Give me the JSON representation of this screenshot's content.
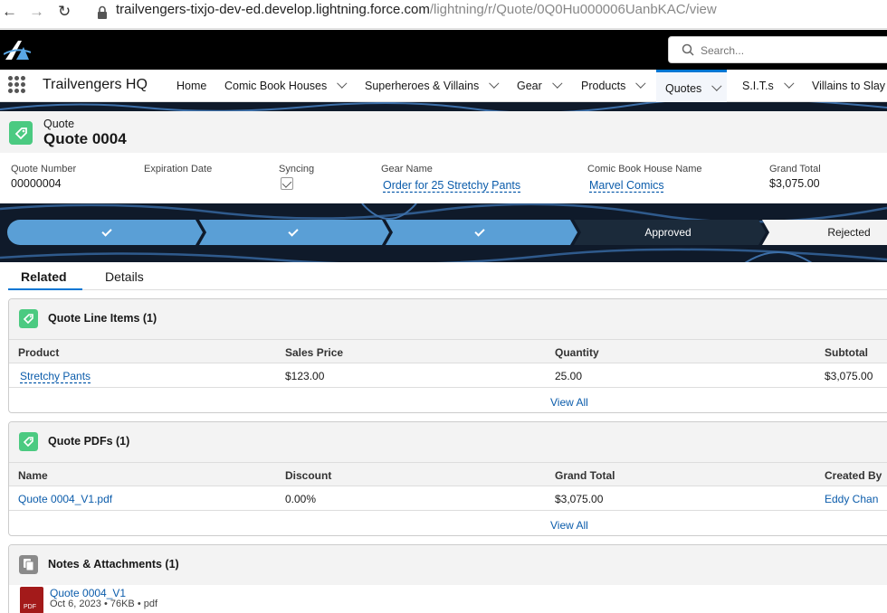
{
  "browser": {
    "url_host": "trailvengers-tixjo-dev-ed.develop.lightning.force.com",
    "url_path": "/lightning/r/Quote/0Q0Hu000006UanbKAC/view"
  },
  "header": {
    "search_placeholder": "Search..."
  },
  "app": {
    "name": "Trailvengers HQ",
    "nav": [
      {
        "label": "Home"
      },
      {
        "label": "Comic Book Houses"
      },
      {
        "label": "Superheroes & Villains"
      },
      {
        "label": "Gear"
      },
      {
        "label": "Products"
      },
      {
        "label": "Quotes"
      },
      {
        "label": "S.I.T.s"
      },
      {
        "label": "Villains to Slay"
      }
    ],
    "active_nav": "Quotes"
  },
  "record": {
    "object_label": "Quote",
    "name": "Quote 0004",
    "fields": {
      "quote_number": {
        "label": "Quote Number",
        "value": "00000004"
      },
      "expiration_date": {
        "label": "Expiration Date",
        "value": ""
      },
      "syncing": {
        "label": "Syncing",
        "checked": true
      },
      "gear_name": {
        "label": "Gear Name",
        "value": "Order for 25 Stretchy Pants"
      },
      "comic_house": {
        "label": "Comic Book House Name",
        "value": "Marvel Comics"
      },
      "grand_total": {
        "label": "Grand Total",
        "value": "$3,075.00"
      }
    }
  },
  "path": {
    "current": "Approved",
    "next": "Rejected",
    "completed_count": 3
  },
  "tabs": {
    "related": "Related",
    "details": "Details"
  },
  "quote_line_items": {
    "title": "Quote Line Items (1)",
    "columns": [
      "Product",
      "Sales Price",
      "Quantity",
      "Subtotal"
    ],
    "rows": [
      [
        "Stretchy Pants",
        "$123.00",
        "25.00",
        "$3,075.00"
      ]
    ],
    "view_all": "View All"
  },
  "quote_pdfs": {
    "title": "Quote PDFs (1)",
    "columns": [
      "Name",
      "Discount",
      "Grand Total",
      "Created By"
    ],
    "rows": [
      [
        "Quote 0004_V1.pdf",
        "0.00%",
        "$3,075.00",
        "Eddy Chan"
      ]
    ],
    "view_all": "View All"
  },
  "notes": {
    "title": "Notes & Attachments (1)",
    "file_name": "Quote 0004_V1",
    "file_date": "Oct 6, 2023",
    "file_size": "76KB",
    "file_type": "pdf",
    "file_badge": "PDF"
  },
  "colors": {
    "brand_blue": "#0176d3",
    "path_complete": "#5a9fd6",
    "path_current": "#1b2a3a",
    "link": "#0b5cab",
    "record_icon": "#4bca81"
  }
}
